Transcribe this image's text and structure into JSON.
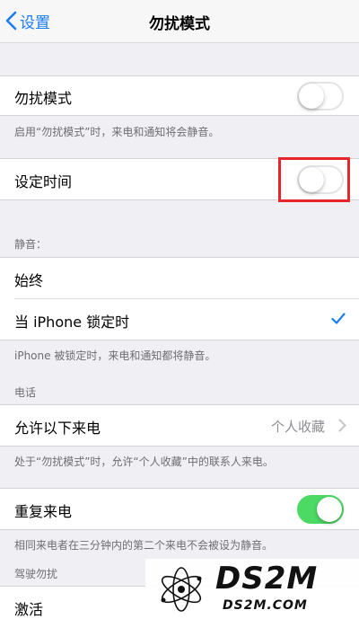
{
  "nav": {
    "back_label": "设置",
    "title": "勿扰模式"
  },
  "dnd": {
    "label": "勿扰模式",
    "enabled": false,
    "footer": "启用“勿扰模式”时，来电和通知将会静音。"
  },
  "scheduled": {
    "label": "设定时间",
    "enabled": false
  },
  "silence": {
    "header": "静音：",
    "options": [
      {
        "label": "始终",
        "selected": false
      },
      {
        "label": "当 iPhone 锁定时",
        "selected": true
      }
    ],
    "footer": "iPhone 被锁定时，来电和通知都将静音。"
  },
  "phone": {
    "header": "电话",
    "allow_calls_label": "允许以下来电",
    "allow_calls_value": "个人收藏",
    "footer": "处于“勿扰模式”时，允许“个人收藏”中的联系人来电。"
  },
  "repeated": {
    "label": "重复来电",
    "enabled": true,
    "footer": "相同来电者在三分钟内的第二个来电不会被设为静音。"
  },
  "driving": {
    "header": "驾驶勿扰",
    "activate_label": "激活"
  },
  "watermark": {
    "brand": "DS2M",
    "domain": "DS2M.COM"
  },
  "colors": {
    "accent": "#1a7cf5",
    "toggle_on": "#4cd964",
    "highlight": "#e6262a",
    "background": "#efeff4"
  }
}
